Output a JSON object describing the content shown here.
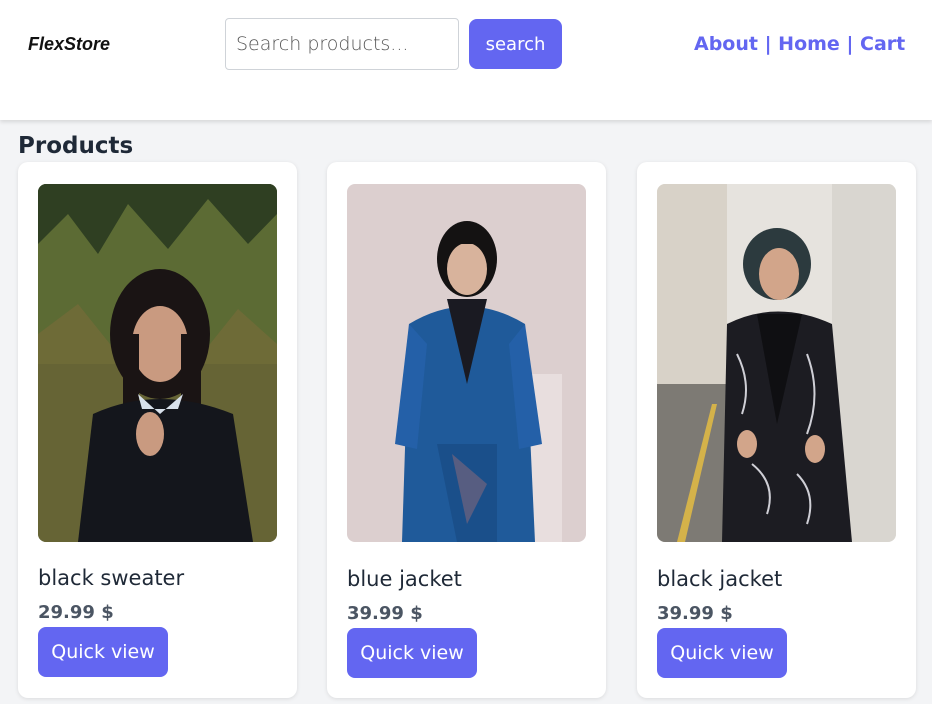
{
  "header": {
    "brand": "FlexStore",
    "search": {
      "placeholder": "Search products...",
      "value": ""
    },
    "search_button": "search",
    "nav": {
      "about": "About",
      "home": "Home",
      "cart": "Cart",
      "separator": "|"
    }
  },
  "section_title": "Products",
  "products": [
    {
      "name": "black sweater",
      "price": "29.99 $",
      "button": "Quick view"
    },
    {
      "name": "blue jacket",
      "price": "39.99 $",
      "button": "Quick view"
    },
    {
      "name": "black jacket",
      "price": "39.99 $",
      "button": "Quick view"
    }
  ],
  "colors": {
    "accent": "#6366f1",
    "background": "#f3f4f6",
    "card": "#ffffff",
    "text": "#1f2937",
    "muted": "#4b5563"
  }
}
